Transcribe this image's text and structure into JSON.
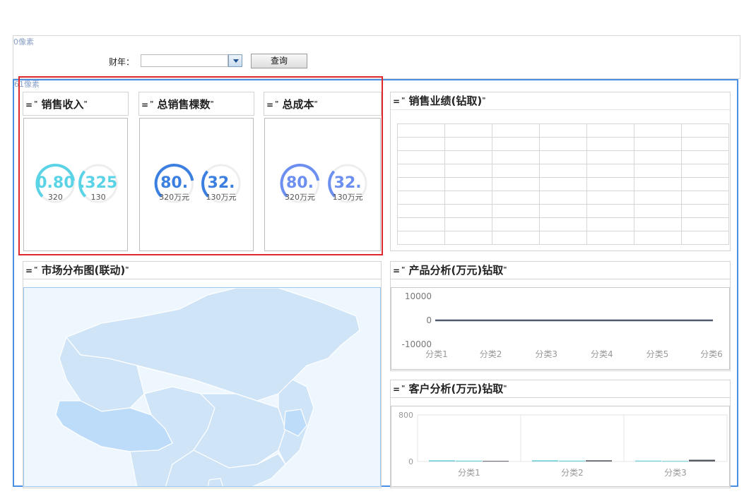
{
  "sections": {
    "top_label": "0像素",
    "main_label": "61像素"
  },
  "filter": {
    "label": "财年：",
    "value": "",
    "query_button": "查询"
  },
  "title_mark": "=",
  "title_quote_open": "\"",
  "title_quote_close": "\"",
  "kpis": [
    {
      "title": "销售收入",
      "gauges": [
        {
          "value_text": "0.80",
          "sub": "320",
          "fill": 0.8,
          "color": "#5bd3e6"
        },
        {
          "value_text": ".325",
          "sub": "130",
          "fill": 0.32,
          "color": "#5bd3e6"
        }
      ]
    },
    {
      "title": "总销售棵数",
      "gauges": [
        {
          "value_text": "80.",
          "sub": "320万元",
          "fill": 0.8,
          "color": "#3b7fe0"
        },
        {
          "value_text": "32.",
          "sub": "130万元",
          "fill": 0.32,
          "color": "#3b7fe0"
        }
      ]
    },
    {
      "title": "总成本",
      "gauges": [
        {
          "value_text": "80.",
          "sub": "320万元",
          "fill": 0.8,
          "color": "#6c8ff0"
        },
        {
          "value_text": "32.",
          "sub": "130万元",
          "fill": 0.32,
          "color": "#6c8ff0"
        }
      ]
    }
  ],
  "sales_panel": {
    "title": "销售业绩(钻取)"
  },
  "map_panel": {
    "title": "市场分布图(联动)"
  },
  "product_panel": {
    "title": "产品分析(万元)钻取"
  },
  "customer_panel": {
    "title": "客户分析(万元)钻取"
  },
  "colors": {
    "line": "#505a6e",
    "bar_teal": "#6dcfd6",
    "bar_dark": "#555a63",
    "map_land": "#cfe4f7",
    "map_highlight": "#bddcfa"
  },
  "chart_data": [
    {
      "type": "line",
      "categories": [
        "分类1",
        "分类2",
        "分类3",
        "分类4",
        "分类5",
        "分类6"
      ],
      "series": [
        {
          "values": [
            0,
            0,
            0,
            0,
            0,
            0
          ]
        }
      ],
      "yticks": [
        "10000",
        "0",
        "-10000"
      ],
      "ylim": [
        -10000,
        10000
      ],
      "grid": false
    },
    {
      "type": "bar",
      "categories": [
        "分类1",
        "分类2",
        "分类3"
      ],
      "series": [
        {
          "values": [
            20,
            20,
            15
          ]
        },
        {
          "values": [
            15,
            15,
            10
          ]
        },
        {
          "values": [
            10,
            20,
            30
          ]
        }
      ],
      "yticks": [
        "800",
        "0"
      ],
      "ylim": [
        0,
        800
      ],
      "grid": true
    }
  ]
}
